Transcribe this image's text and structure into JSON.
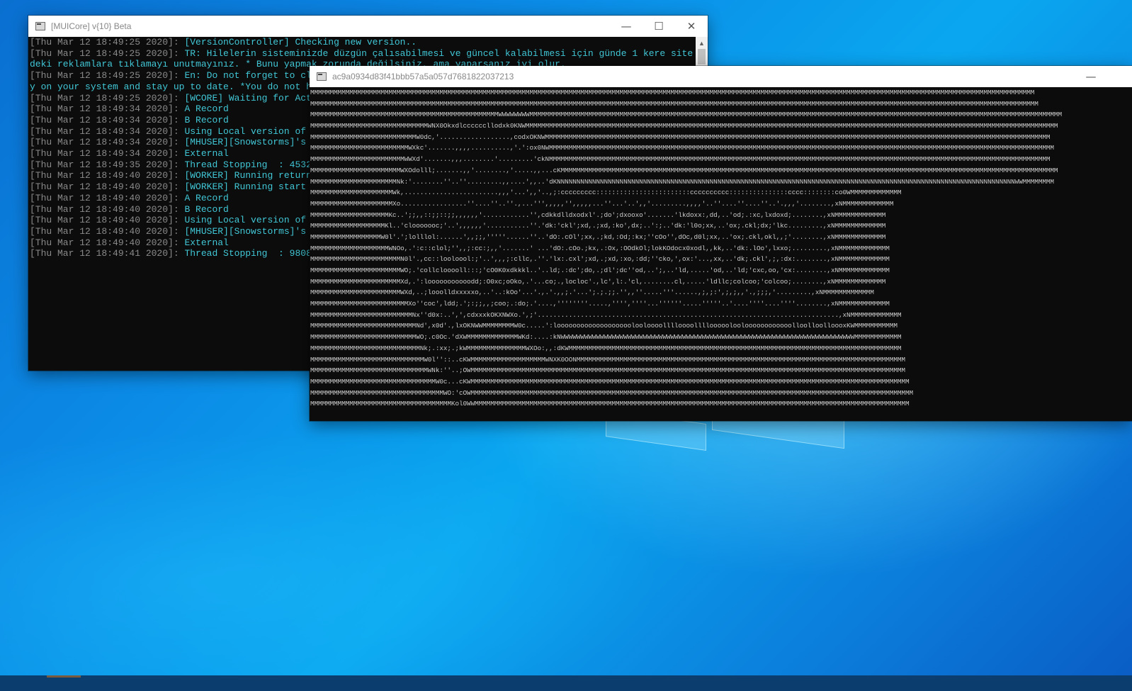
{
  "desktop": {
    "accent": "#0b8be6",
    "logo_icon": "windows-logo"
  },
  "console_window": {
    "title": "[MUICore] v{10} Beta",
    "controls": {
      "minimize": "—",
      "maximize": "☐",
      "close": "✕"
    },
    "colors": {
      "timestamp": "#8a8a8a",
      "message": "#41c7d6",
      "background": "#0c0c0c"
    },
    "lines": [
      {
        "ts": "[Thu Mar 12 18:49:25 2020]: ",
        "msg": "[VersionController] Checking new version.."
      },
      {
        "ts": "[Thu Mar 12 18:49:25 2020]: ",
        "msg": "TR: Hilelerin sisteminizde düzgün çalısabilmesi ve güncel kalabilmesi için günde 1 kere site"
      },
      {
        "ts": "",
        "msg": "deki reklamlara tıklamayı unutmayınız. * Bunu yapmak zorunda değilsiniz, ama yaparsanız iyi olur."
      },
      {
        "ts": "[Thu Mar 12 18:49:25 2020]: ",
        "msg": "En: Do not forget to cl"
      },
      {
        "ts": "",
        "msg": "y on your system and stay up to date. *You do not h"
      },
      {
        "ts": "[Thu Mar 12 18:49:25 2020]: ",
        "msg": "[WCORE] Waiting for Act"
      },
      {
        "ts": "[Thu Mar 12 18:49:34 2020]: ",
        "msg": "A Record"
      },
      {
        "ts": "[Thu Mar 12 18:49:34 2020]: ",
        "msg": "B Record"
      },
      {
        "ts": "[Thu Mar 12 18:49:34 2020]: ",
        "msg": "Using Local version of"
      },
      {
        "ts": "[Thu Mar 12 18:49:34 2020]: ",
        "msg": "[MHUSER][Snowstorms]'s"
      },
      {
        "ts": "[Thu Mar 12 18:49:34 2020]: ",
        "msg": "External"
      },
      {
        "ts": "[Thu Mar 12 18:49:35 2020]: ",
        "msg": "Thread Stopping  : 4532"
      },
      {
        "ts": "[Thu Mar 12 18:49:40 2020]: ",
        "msg": "[WORKER] Running return"
      },
      {
        "ts": "[Thu Mar 12 18:49:40 2020]: ",
        "msg": "[WORKER] Running start"
      },
      {
        "ts": "[Thu Mar 12 18:49:40 2020]: ",
        "msg": "A Record"
      },
      {
        "ts": "[Thu Mar 12 18:49:40 2020]: ",
        "msg": "B Record"
      },
      {
        "ts": "[Thu Mar 12 18:49:40 2020]: ",
        "msg": "Using Local version of"
      },
      {
        "ts": "[Thu Mar 12 18:49:40 2020]: ",
        "msg": "[MHUSER][Snowstorms]'s"
      },
      {
        "ts": "[Thu Mar 12 18:49:40 2020]: ",
        "msg": "External"
      },
      {
        "ts": "[Thu Mar 12 18:49:41 2020]: ",
        "msg": "Thread Stopping  : 9808"
      }
    ]
  },
  "ascii_window": {
    "title": "ac9a0934d83f41bbb57a5a057d7681822037213",
    "controls": {
      "minimize": "—"
    },
    "color": "#cccccc",
    "lines": [
      "MMMMMMMMMMMMMMMMMMMMMMMMMMMMMMMMMMMMMMMMMMMMMMMMMMMMMMMMMMMMMMMMMMMMMMMMMMMMMMMMMMMMMMMMMMMMMMMMMMMMMMMMMMMMMMMMMMMMMMMMMMMMMMMMMMMMMMMMMMMMMMMMMMMMMMMMMMMMMMMMMMMMMMMMMMMMMMMMMMMMMMMMM",
      "MMMMMMMMMMMMMMMMMMMMMMMMMMMMMMMMMMMMMMMMMMMMMMMMMMMMMMMMMMMMMMMMMMMMMMMMMMMMMMMMMMMMMMMMMMMMMMMMMMMMMMMMMMMMMMMMMMMMMMMMMMMMMMMMMMMMMMMMMMMMMMMMMMMMMMMMMMMMMMMMMMMMMMMMMMMMMMMMMMMMMMMMMM",
      "MMMMMMMMMMMMMMMMMMMMMMMMMMMMMMMMMMMMMMMMMMMMMMMMWWWWWWWWMMMMMMMMMMMMMMMMMMMMMMMMMMMMMMMMMMMMMMMMMMMMMMMMMMMMMMMMMMMMMMMMMMMMMMMMMMMMMMMMMMMMMMMMMMMMMMMMMMMMMMMMMMMMMMMMMMMMMMMMMMMMMMMMMMMMMMMM",
      "MMMMMMMMMMMMMMMMMMMMMMMMMMMMMMWNX0Okxdlccccccllodxk0KNWMMMMMMMMMMMMMMMMMMMMMMMMMMMMMMMMMMMMMMMMMMMMMMMMMMMMMMMMMMMMMMMMMMMMMMMMMMMMMMMMMMMMMMMMMMMMMMMMMMMMMMMMMMMMMMMMMMMMMMMMMMMMMMMMMMMMMMMM",
      "MMMMMMMMMMMMMMMMMMMMMMMMMMMW0dc,'..................,codxOKNWMMMMMMMMMMMMMMMMMMMMMMMMMMMMMMMMMMMMMMMMMMMMMMMMMMMMMMMMMMMMMMMMMMMMMMMMMMMMMMMMMMMMMMMMMMMMMMMMMMMMMMMMMMMMMMMMMMMMMMMMMMMMMMMMM",
      "MMMMMMMMMMMMMMMMMMMMMMMMMWXkc'.......,,,,..........,'.':ox0NWMMMMMMMMMMMMMMMMMMMMMMMMMMMMMMMMMMMMMMMMMMMMMMMMMMMMMMMMMMMMMMMMMMMMMMMMMMMMMMMMMMMMMMMMMMMMMMMMMMMMMMMMMMMMMMMMMMMMMMMMMMMMMMMMM",
      "MMMMMMMMMMMMMMMMMMMMMMMMWWXd'.......,,,........'.........'ckNMMMMMMMMMMMMMMMMMMMMMMMMMMMMMMMMMMMMMMMMMMMMMMMMMMMMMMMMMMMMMMMMMMMMMMMMMMMMMMMMMMMMMMMMMMMMMMMMMMMMMMMMMMMMMMMMMMMMMMMMMMMMMMMM",
      "MMMMMMMMMMMMMMMMMMMMMMMWXOdolll;.......,,'........,'.....,,...cKMMMMMMMMMMMMMMMMMMMMMMMMMMMMMMMMMMMMMMMMMMMMMMMMMMMMMMMMMMMMMMMMMMMMMMMMMMMMMMMMMMMMMMMMMMMMMMMMMMMMMMMMMMMMMMMMMMMMMMMMMMMMMMM",
      "MMMMMMMMMMMMMMMMMMMMMMNk:'........''..''.........,,....',,..'dKNNNNNNNNNNNNNNNNNNNNNNNNNNNNNNNNNNNNNNNNNNNNNNNNNNNNNNNNNNNNNNNNNNNNNNNNNNNNNNNNNNNNNNNNNNNNNNNNNNNNNNNNNNNNNNNNNNNNNWWMMMMMMMM",
      "MMMMMMMMMMMMMMMMMMMMMWk,........................,,,'...',,'..,;:ccccccccc::::::::::::::::::::::::cccccccccc:::::::::::::::cccc::::::::co0WMMMMMMMMMMMMM",
      "MMMMMMMMMMMMMMMMMMMMMXo.................''....''..''.,...''',,,,,'',,,,,...''...'..',,'.........,,,,'..''....''....''..'.,,,'........,xNMMMMMMMMMMMMM",
      "MMMMMMMMMMMMMMMMMMMMKc..';;,,::;;::;;,,,,,,'............'',cdkkdlldxodxl'.;do';dxooxo'.......'lkdoxx:,dd,..'od;.:xc,lxdoxd;........,xNMMMMMMMMMMMMM",
      "MMMMMMMMMMMMMMMMMMMKl..'clooooooc;'..',,,,,,'...........''.'dk:'ckl';xd,.;xd,:ko',dx;..':;..'dk:'l0o;xx,..'ox;.ckl;dx;'lkc.........,xNMMMMMMMMMMMMM",
      "MMMMMMMMMMMMMMMMMMW0l'.';lolllol:......',,;;,'''''......''..'dO:.cOl';xx,.;kd,:Od;:kx;''cOo'',dOc,d0l;xx,..'ox;.ckl,okl,,;'........,xNMMMMMMMMMMMMM",
      "MMMMMMMMMMMMMMMMMMMMWNOo,.':c::clol;'',,;:cc:;,,'.......' ...'dO:.cOo.;kx,.:Ox,:OOdkOl;lokKOdocx0xodl,,kk,..'dk:.lOo',lxxo;.........,xNMMMMMMMMMMMMM",
      "MMMMMMMMMMMMMMMMMMMMMMMN0l'.,cc::looloool:;'..',,,;:cllc,.''.'lx:.cxl';xd,.;xd,:xo,:dd;''cko,',ox:'...,xx,..'dk;.ckl',;,:dx:........,xNMMMMMMMMMMMMM",
      "MMMMMMMMMMMMMMMMMMMMMMMWO;.'collclooooll:::;'cO0K0xdkkkl..'..ld;.:dc';do,.;dl';dc''od,..';,..'ld,.....'od,..'ld;'cxc,oo,'cx:........,xNMMMMMMMMMMMMM",
      "MMMMMMMMMMMMMMMMMMMMMMMXd,.':looooooooooodd;:O0xc;oOko,.'...co;.,locloc'.,lc',l:.'cl,........cl,.....'ldllc;colcoo;'colcoo;........,xNMMMMMMMMMMMMM",
      "MMMMMMMMMMMMMMMMMMMMMMMWXd,..;looolldxxxxxo,..'..:kOo'...'.,.'.,,;.'...';.;.;;.'',,''.....'''......,;,;:',;,;,,'.,;;;,'.........,xNMMMMMMMMMMMMM",
      "MMMMMMMMMMMMMMMMMMMMMMMMMXo''coc',ldd;.';:;;,,;coo;.:do;.'....,''''''''.....,'''',''''...''''''.....'''''..'....''''....''''........,xNMMMMMMMMMMMMM",
      "MMMMMMMMMMMMMMMMMMMMMMMMMMNx''d0x:..',',cdxxxkOKXNWXo.',;'.............................................................................,xNMMMMMMMMMMMMM",
      "MMMMMMMMMMMMMMMMMMMMMMMMMMMNd',x0d'.,lxOKNWWMMMMMMMMW0c.....':looooooooooooooooooolooloooolllloooollllooooolooloooooooooooolloolloolloooxKWMMMMMMMMMMM",
      "MMMMMMMMMMMMMMMMMMMMMMMMMMMWO;.c0Oc.'dXWMMMMMMMMMMMMMWKd:....:kNWWWWWWWWWWWWWWWWWWWWWWWWWWWWWWWWWWWWWWWWWWWWWWWWWWWWWWWWWWWWWWWWWWWWWWWWWWWMMMMMMMMMMMM",
      "MMMMMMMMMMMMMMMMMMMMMMMMMMMMNk;.:xx;.;kWMMMMMMMMMMMMMMMWXOo:,,:dKWMMMMMMMMMMMMMMMMMMMMMMMMMMMMMMMMMMMMMMMMMMMMMMMMMMMMMMMMMMMMMMMMMMMMMMMMMMMMMMMMMMMMM",
      "MMMMMMMMMMMMMMMMMMMMMMMMMMMMMW0l''::..cKWMMMMMMMMMMMMMMMMMMMWNXK0OONMMMMMMMMMMMMMMMMMMMMMMMMMMMMMMMMMMMMMMMMMMMMMMMMMMMMMMMMMMMMMMMMMMMMMMMMMMMMMMMMMMMM",
      "MMMMMMMMMMMMMMMMMMMMMMMMMMMMMMWNk:''..;OWMMMMMMMMMMMMMMMMMMMMMMMMMMMMMMMMMMMMMMMMMMMMMMMMMMMMMMMMMMMMMMMMMMMMMMMMMMMMMMMMMMMMMMMMMMMMMMMMMMMMMMMMMMMMMMM",
      "MMMMMMMMMMMMMMMMMMMMMMMMMMMMMMMMW0c...cKWMMMMMMMMMMMMMMMMMMMMMMMMMMMMMMMMMMMMMMMMMMMMMMMMMMMMMMMMMMMMMMMMMMMMMMMMMMMMMMMMMMMMMMMMMMMMMMMMMMMMMMMMMMMMMMMM",
      "MMMMMMMMMMMMMMMMMMMMMMMMMMMMMMMMMMWO:'cOWMMMMMMMMMMMMMMMMMMMMMMMMMMMMMMMMMMMMMMMMMMMMMMMMMMMMMMMMMMMMMMMMMMMMMMMMMMMMMMMMMMMMMMMMMMMMMMMMMMMMMMMMMMMMMMMMM",
      "MMMMMMMMMMMMMMMMMMMMMMMMMMMMMMMMMMMMKol0WWMMMMMMMMMMMMMMMMMMMMMMMMMMMMMMMMMMMMMMMMMMMMMMMMMMMMMMMMMMMMMMMMMMMMMMMMMMMMMMMMMMMMMMMMMMMMMMMMMMMMMMMMMMMMMMM"
    ]
  }
}
